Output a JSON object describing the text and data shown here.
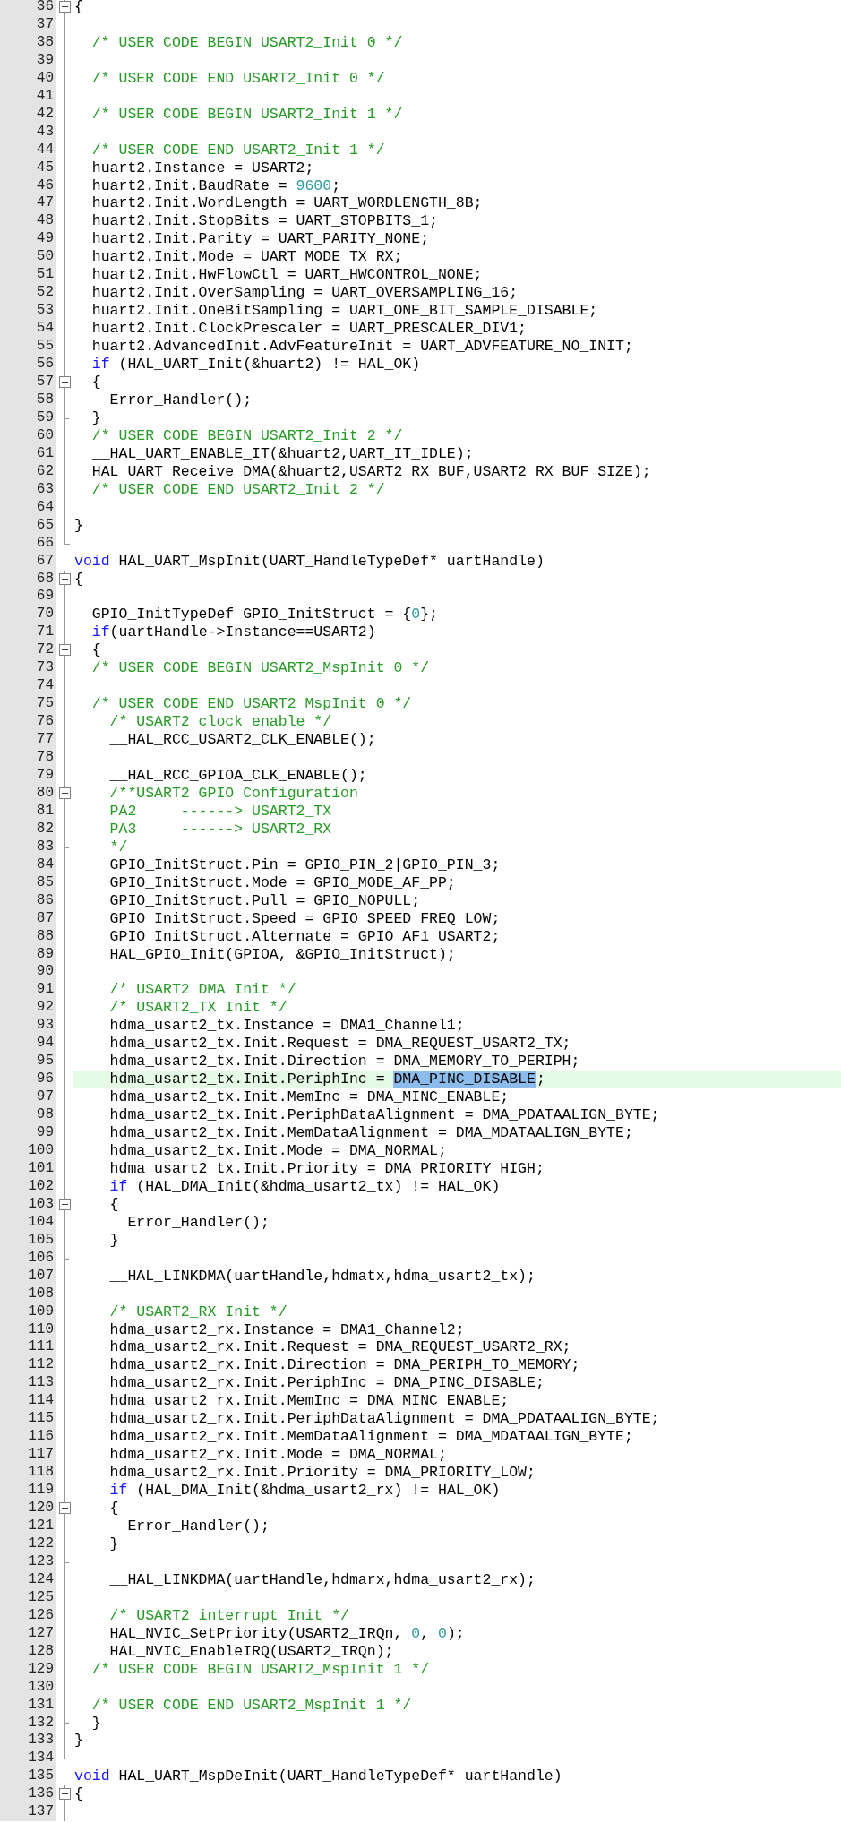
{
  "editor": {
    "lines": [
      {
        "number": "36",
        "kind": "fold-start",
        "current": false,
        "code": [
          {
            "kind": "plain",
            "text": "{"
          }
        ]
      },
      {
        "number": "37",
        "kind": "fold-body",
        "current": false
      },
      {
        "number": "38",
        "kind": "fold-body",
        "current": false,
        "code": [
          {
            "kind": "comment",
            "text": "  /* USER CODE BEGIN USART2_Init 0 */"
          }
        ]
      },
      {
        "number": "39",
        "kind": "fold-body",
        "current": false
      },
      {
        "number": "40",
        "kind": "fold-body",
        "current": false,
        "code": [
          {
            "kind": "comment",
            "text": "  /* USER CODE END USART2_Init 0 */"
          }
        ]
      },
      {
        "number": "41",
        "kind": "fold-body",
        "current": false
      },
      {
        "number": "42",
        "kind": "fold-body",
        "current": false,
        "code": [
          {
            "kind": "comment",
            "text": "  /* USER CODE BEGIN USART2_Init 1 */"
          }
        ]
      },
      {
        "number": "43",
        "kind": "fold-body",
        "current": false
      },
      {
        "number": "44",
        "kind": "fold-body",
        "current": false,
        "code": [
          {
            "kind": "comment",
            "text": "  /* USER CODE END USART2_Init 1 */"
          }
        ]
      },
      {
        "number": "45",
        "kind": "fold-body",
        "current": false,
        "code": [
          {
            "kind": "plain",
            "text": "  huart2.Instance = USART2;"
          }
        ]
      },
      {
        "number": "46",
        "kind": "fold-body",
        "current": false,
        "code": [
          {
            "kind": "plain",
            "text": "  huart2.Init.BaudRate = "
          },
          {
            "kind": "number",
            "text": "9600"
          },
          {
            "kind": "plain",
            "text": ";"
          }
        ]
      },
      {
        "number": "47",
        "kind": "fold-body",
        "current": false,
        "code": [
          {
            "kind": "plain",
            "text": "  huart2.Init.WordLength = UART_WORDLENGTH_8B;"
          }
        ]
      },
      {
        "number": "48",
        "kind": "fold-body",
        "current": false,
        "code": [
          {
            "kind": "plain",
            "text": "  huart2.Init.StopBits = UART_STOPBITS_1;"
          }
        ]
      },
      {
        "number": "49",
        "kind": "fold-body",
        "current": false,
        "code": [
          {
            "kind": "plain",
            "text": "  huart2.Init.Parity = UART_PARITY_NONE;"
          }
        ]
      },
      {
        "number": "50",
        "kind": "fold-body",
        "current": false,
        "code": [
          {
            "kind": "plain",
            "text": "  huart2.Init.Mode = UART_MODE_TX_RX;"
          }
        ]
      },
      {
        "number": "51",
        "kind": "fold-body",
        "current": false,
        "code": [
          {
            "kind": "plain",
            "text": "  huart2.Init.HwFlowCtl = UART_HWCONTROL_NONE;"
          }
        ]
      },
      {
        "number": "52",
        "kind": "fold-body",
        "current": false,
        "code": [
          {
            "kind": "plain",
            "text": "  huart2.Init.OverSampling = UART_OVERSAMPLING_16;"
          }
        ]
      },
      {
        "number": "53",
        "kind": "fold-body",
        "current": false,
        "code": [
          {
            "kind": "plain",
            "text": "  huart2.Init.OneBitSampling = UART_ONE_BIT_SAMPLE_DISABLE;"
          }
        ]
      },
      {
        "number": "54",
        "kind": "fold-body",
        "current": false,
        "code": [
          {
            "kind": "plain",
            "text": "  huart2.Init.ClockPrescaler = UART_PRESCALER_DIV1;"
          }
        ]
      },
      {
        "number": "55",
        "kind": "fold-body",
        "current": false,
        "code": [
          {
            "kind": "plain",
            "text": "  huart2.AdvancedInit.AdvFeatureInit = UART_ADVFEATURE_NO_INIT;"
          }
        ]
      },
      {
        "number": "56",
        "kind": "fold-body",
        "current": false,
        "code": [
          {
            "kind": "keyword",
            "text": "  if"
          },
          {
            "kind": "plain",
            "text": " (HAL_UART_Init(&huart2) != HAL_OK)"
          }
        ]
      },
      {
        "number": "57",
        "kind": "fold-start",
        "current": false,
        "code": [
          {
            "kind": "plain",
            "text": "  {"
          }
        ]
      },
      {
        "number": "58",
        "kind": "fold-body",
        "current": false,
        "code": [
          {
            "kind": "plain",
            "text": "    Error_Handler();"
          }
        ]
      },
      {
        "number": "59",
        "kind": "fold-tail",
        "current": false,
        "code": [
          {
            "kind": "plain",
            "text": "  }"
          }
        ]
      },
      {
        "number": "60",
        "kind": "fold-body",
        "current": false,
        "code": [
          {
            "kind": "comment",
            "text": "  /* USER CODE BEGIN USART2_Init 2 */"
          }
        ]
      },
      {
        "number": "61",
        "kind": "fold-body",
        "current": false,
        "code": [
          {
            "kind": "plain",
            "text": "  __HAL_UART_ENABLE_IT(&huart2,UART_IT_IDLE);"
          }
        ]
      },
      {
        "number": "62",
        "kind": "fold-body",
        "current": false,
        "code": [
          {
            "kind": "plain",
            "text": "  HAL_UART_Receive_DMA(&huart2,USART2_RX_BUF,USART2_RX_BUF_SIZE);"
          }
        ]
      },
      {
        "number": "63",
        "kind": "fold-body",
        "current": false,
        "code": [
          {
            "kind": "comment",
            "text": "  /* USER CODE END USART2_Init 2 */"
          }
        ]
      },
      {
        "number": "64",
        "kind": "fold-body",
        "current": false
      },
      {
        "number": "65",
        "kind": "fold-body",
        "current": false,
        "code": [
          {
            "kind": "plain",
            "text": "}"
          }
        ]
      },
      {
        "number": "66",
        "kind": "fold-end",
        "current": false
      },
      {
        "number": "67",
        "kind": "plain",
        "current": false,
        "code": [
          {
            "kind": "keyword",
            "text": "void"
          },
          {
            "kind": "plain",
            "text": " HAL_UART_MspInit(UART_HandleTypeDef* uartHandle)"
          }
        ]
      },
      {
        "number": "68",
        "kind": "fold-start",
        "current": false,
        "code": [
          {
            "kind": "plain",
            "text": "{"
          }
        ]
      },
      {
        "number": "69",
        "kind": "fold-body",
        "current": false
      },
      {
        "number": "70",
        "kind": "fold-body",
        "current": false,
        "code": [
          {
            "kind": "plain",
            "text": "  GPIO_InitTypeDef GPIO_InitStruct = {"
          },
          {
            "kind": "number",
            "text": "0"
          },
          {
            "kind": "plain",
            "text": "};"
          }
        ]
      },
      {
        "number": "71",
        "kind": "fold-body",
        "current": false,
        "code": [
          {
            "kind": "keyword",
            "text": "  if"
          },
          {
            "kind": "plain",
            "text": "(uartHandle->Instance==USART2)"
          }
        ]
      },
      {
        "number": "72",
        "kind": "fold-start",
        "current": false,
        "code": [
          {
            "kind": "plain",
            "text": "  {"
          }
        ]
      },
      {
        "number": "73",
        "kind": "fold-body",
        "current": false,
        "code": [
          {
            "kind": "comment",
            "text": "  /* USER CODE BEGIN USART2_MspInit 0 */"
          }
        ]
      },
      {
        "number": "74",
        "kind": "fold-body",
        "current": false
      },
      {
        "number": "75",
        "kind": "fold-body",
        "current": false,
        "code": [
          {
            "kind": "comment",
            "text": "  /* USER CODE END USART2_MspInit 0 */"
          }
        ]
      },
      {
        "number": "76",
        "kind": "fold-body",
        "current": false,
        "code": [
          {
            "kind": "comment",
            "text": "    /* USART2 clock enable */"
          }
        ]
      },
      {
        "number": "77",
        "kind": "fold-body",
        "current": false,
        "code": [
          {
            "kind": "plain",
            "text": "    __HAL_RCC_USART2_CLK_ENABLE();"
          }
        ]
      },
      {
        "number": "78",
        "kind": "fold-body",
        "current": false
      },
      {
        "number": "79",
        "kind": "fold-body",
        "current": false,
        "code": [
          {
            "kind": "plain",
            "text": "    __HAL_RCC_GPIOA_CLK_ENABLE();"
          }
        ]
      },
      {
        "number": "80",
        "kind": "fold-start",
        "current": false,
        "code": [
          {
            "kind": "comment",
            "text": "    /**USART2 GPIO Configuration"
          }
        ]
      },
      {
        "number": "81",
        "kind": "fold-body",
        "current": false,
        "code": [
          {
            "kind": "comment",
            "text": "    PA2     ------> USART2_TX"
          }
        ]
      },
      {
        "number": "82",
        "kind": "fold-body",
        "current": false,
        "code": [
          {
            "kind": "comment",
            "text": "    PA3     ------> USART2_RX"
          }
        ]
      },
      {
        "number": "83",
        "kind": "fold-tail",
        "current": false,
        "code": [
          {
            "kind": "comment",
            "text": "    */"
          }
        ]
      },
      {
        "number": "84",
        "kind": "fold-body",
        "current": false,
        "code": [
          {
            "kind": "plain",
            "text": "    GPIO_InitStruct.Pin = GPIO_PIN_2|GPIO_PIN_3;"
          }
        ]
      },
      {
        "number": "85",
        "kind": "fold-body",
        "current": false,
        "code": [
          {
            "kind": "plain",
            "text": "    GPIO_InitStruct.Mode = GPIO_MODE_AF_PP;"
          }
        ]
      },
      {
        "number": "86",
        "kind": "fold-body",
        "current": false,
        "code": [
          {
            "kind": "plain",
            "text": "    GPIO_InitStruct.Pull = GPIO_NOPULL;"
          }
        ]
      },
      {
        "number": "87",
        "kind": "fold-body",
        "current": false,
        "code": [
          {
            "kind": "plain",
            "text": "    GPIO_InitStruct.Speed = GPIO_SPEED_FREQ_LOW;"
          }
        ]
      },
      {
        "number": "88",
        "kind": "fold-body",
        "current": false,
        "code": [
          {
            "kind": "plain",
            "text": "    GPIO_InitStruct.Alternate = GPIO_AF1_USART2;"
          }
        ]
      },
      {
        "number": "89",
        "kind": "fold-body",
        "current": false,
        "code": [
          {
            "kind": "plain",
            "text": "    HAL_GPIO_Init(GPIOA, &GPIO_InitStruct);"
          }
        ]
      },
      {
        "number": "90",
        "kind": "fold-body",
        "current": false
      },
      {
        "number": "91",
        "kind": "fold-body",
        "current": false,
        "code": [
          {
            "kind": "comment",
            "text": "    /* USART2 DMA Init */"
          }
        ]
      },
      {
        "number": "92",
        "kind": "fold-body",
        "current": false,
        "code": [
          {
            "kind": "comment",
            "text": "    /* USART2_TX Init */"
          }
        ]
      },
      {
        "number": "93",
        "kind": "fold-body",
        "current": false,
        "code": [
          {
            "kind": "plain",
            "text": "    hdma_usart2_tx.Instance = DMA1_Channel1;"
          }
        ]
      },
      {
        "number": "94",
        "kind": "fold-body",
        "current": false,
        "code": [
          {
            "kind": "plain",
            "text": "    hdma_usart2_tx.Init.Request = DMA_REQUEST_USART2_TX;"
          }
        ]
      },
      {
        "number": "95",
        "kind": "fold-body",
        "current": false,
        "code": [
          {
            "kind": "plain",
            "text": "    hdma_usart2_tx.Init.Direction = DMA_MEMORY_TO_PERIPH;"
          }
        ]
      },
      {
        "number": "96",
        "kind": "fold-body",
        "current": true,
        "code": [
          {
            "kind": "plain",
            "text": "    hdma_usart2_tx.Init.PeriphInc = "
          },
          {
            "kind": "selection",
            "text": "DMA_PINC_DISABLE"
          },
          {
            "kind": "plain",
            "text": ";"
          }
        ]
      },
      {
        "number": "97",
        "kind": "fold-body",
        "current": false,
        "code": [
          {
            "kind": "plain",
            "text": "    hdma_usart2_tx.Init.MemInc = DMA_MINC_ENABLE;"
          }
        ]
      },
      {
        "number": "98",
        "kind": "fold-body",
        "current": false,
        "code": [
          {
            "kind": "plain",
            "text": "    hdma_usart2_tx.Init.PeriphDataAlignment = DMA_PDATAALIGN_BYTE;"
          }
        ]
      },
      {
        "number": "99",
        "kind": "fold-body",
        "current": false,
        "code": [
          {
            "kind": "plain",
            "text": "    hdma_usart2_tx.Init.MemDataAlignment = DMA_MDATAALIGN_BYTE;"
          }
        ]
      },
      {
        "number": "100",
        "kind": "fold-body",
        "current": false,
        "code": [
          {
            "kind": "plain",
            "text": "    hdma_usart2_tx.Init.Mode = DMA_NORMAL;"
          }
        ]
      },
      {
        "number": "101",
        "kind": "fold-body",
        "current": false,
        "code": [
          {
            "kind": "plain",
            "text": "    hdma_usart2_tx.Init.Priority = DMA_PRIORITY_HIGH;"
          }
        ]
      },
      {
        "number": "102",
        "kind": "fold-body",
        "current": false,
        "code": [
          {
            "kind": "keyword",
            "text": "    if"
          },
          {
            "kind": "plain",
            "text": " (HAL_DMA_Init(&hdma_usart2_tx) != HAL_OK)"
          }
        ]
      },
      {
        "number": "103",
        "kind": "fold-start",
        "current": false,
        "code": [
          {
            "kind": "plain",
            "text": "    {"
          }
        ]
      },
      {
        "number": "104",
        "kind": "fold-body",
        "current": false,
        "code": [
          {
            "kind": "plain",
            "text": "      Error_Handler();"
          }
        ]
      },
      {
        "number": "105",
        "kind": "fold-body",
        "current": false,
        "code": [
          {
            "kind": "plain",
            "text": "    }"
          }
        ]
      },
      {
        "number": "106",
        "kind": "fold-tail",
        "current": false
      },
      {
        "number": "107",
        "kind": "fold-body",
        "current": false,
        "code": [
          {
            "kind": "plain",
            "text": "    __HAL_LINKDMA(uartHandle,hdmatx,hdma_usart2_tx);"
          }
        ]
      },
      {
        "number": "108",
        "kind": "fold-body",
        "current": false
      },
      {
        "number": "109",
        "kind": "fold-body",
        "current": false,
        "code": [
          {
            "kind": "comment",
            "text": "    /* USART2_RX Init */"
          }
        ]
      },
      {
        "number": "110",
        "kind": "fold-body",
        "current": false,
        "code": [
          {
            "kind": "plain",
            "text": "    hdma_usart2_rx.Instance = DMA1_Channel2;"
          }
        ]
      },
      {
        "number": "111",
        "kind": "fold-body",
        "current": false,
        "code": [
          {
            "kind": "plain",
            "text": "    hdma_usart2_rx.Init.Request = DMA_REQUEST_USART2_RX;"
          }
        ]
      },
      {
        "number": "112",
        "kind": "fold-body",
        "current": false,
        "code": [
          {
            "kind": "plain",
            "text": "    hdma_usart2_rx.Init.Direction = DMA_PERIPH_TO_MEMORY;"
          }
        ]
      },
      {
        "number": "113",
        "kind": "fold-body",
        "current": false,
        "code": [
          {
            "kind": "plain",
            "text": "    hdma_usart2_rx.Init.PeriphInc = DMA_PINC_DISABLE;"
          }
        ]
      },
      {
        "number": "114",
        "kind": "fold-body",
        "current": false,
        "code": [
          {
            "kind": "plain",
            "text": "    hdma_usart2_rx.Init.MemInc = DMA_MINC_ENABLE;"
          }
        ]
      },
      {
        "number": "115",
        "kind": "fold-body",
        "current": false,
        "code": [
          {
            "kind": "plain",
            "text": "    hdma_usart2_rx.Init.PeriphDataAlignment = DMA_PDATAALIGN_BYTE;"
          }
        ]
      },
      {
        "number": "116",
        "kind": "fold-body",
        "current": false,
        "code": [
          {
            "kind": "plain",
            "text": "    hdma_usart2_rx.Init.MemDataAlignment = DMA_MDATAALIGN_BYTE;"
          }
        ]
      },
      {
        "number": "117",
        "kind": "fold-body",
        "current": false,
        "code": [
          {
            "kind": "plain",
            "text": "    hdma_usart2_rx.Init.Mode = DMA_NORMAL;"
          }
        ]
      },
      {
        "number": "118",
        "kind": "fold-body",
        "current": false,
        "code": [
          {
            "kind": "plain",
            "text": "    hdma_usart2_rx.Init.Priority = DMA_PRIORITY_LOW;"
          }
        ]
      },
      {
        "number": "119",
        "kind": "fold-body",
        "current": false,
        "code": [
          {
            "kind": "keyword",
            "text": "    if"
          },
          {
            "kind": "plain",
            "text": " (HAL_DMA_Init(&hdma_usart2_rx) != HAL_OK)"
          }
        ]
      },
      {
        "number": "120",
        "kind": "fold-start",
        "current": false,
        "code": [
          {
            "kind": "plain",
            "text": "    {"
          }
        ]
      },
      {
        "number": "121",
        "kind": "fold-body",
        "current": false,
        "code": [
          {
            "kind": "plain",
            "text": "      Error_Handler();"
          }
        ]
      },
      {
        "number": "122",
        "kind": "fold-body",
        "current": false,
        "code": [
          {
            "kind": "plain",
            "text": "    }"
          }
        ]
      },
      {
        "number": "123",
        "kind": "fold-tail",
        "current": false
      },
      {
        "number": "124",
        "kind": "fold-body",
        "current": false,
        "code": [
          {
            "kind": "plain",
            "text": "    __HAL_LINKDMA(uartHandle,hdmarx,hdma_usart2_rx);"
          }
        ]
      },
      {
        "number": "125",
        "kind": "fold-body",
        "current": false
      },
      {
        "number": "126",
        "kind": "fold-body",
        "current": false,
        "code": [
          {
            "kind": "comment",
            "text": "    /* USART2 interrupt Init */"
          }
        ]
      },
      {
        "number": "127",
        "kind": "fold-body",
        "current": false,
        "code": [
          {
            "kind": "plain",
            "text": "    HAL_NVIC_SetPriority(USART2_IRQn, "
          },
          {
            "kind": "number",
            "text": "0"
          },
          {
            "kind": "plain",
            "text": ", "
          },
          {
            "kind": "number",
            "text": "0"
          },
          {
            "kind": "plain",
            "text": ");"
          }
        ]
      },
      {
        "number": "128",
        "kind": "fold-body",
        "current": false,
        "code": [
          {
            "kind": "plain",
            "text": "    HAL_NVIC_EnableIRQ(USART2_IRQn);"
          }
        ]
      },
      {
        "number": "129",
        "kind": "fold-body",
        "current": false,
        "code": [
          {
            "kind": "comment",
            "text": "  /* USER CODE BEGIN USART2_MspInit 1 */"
          }
        ]
      },
      {
        "number": "130",
        "kind": "fold-body",
        "current": false
      },
      {
        "number": "131",
        "kind": "fold-body",
        "current": false,
        "code": [
          {
            "kind": "comment",
            "text": "  /* USER CODE END USART2_MspInit 1 */"
          }
        ]
      },
      {
        "number": "132",
        "kind": "fold-tail",
        "current": false,
        "code": [
          {
            "kind": "plain",
            "text": "  }"
          }
        ]
      },
      {
        "number": "133",
        "kind": "fold-body",
        "current": false,
        "code": [
          {
            "kind": "plain",
            "text": "}"
          }
        ]
      },
      {
        "number": "134",
        "kind": "fold-end",
        "current": false
      },
      {
        "number": "135",
        "kind": "plain",
        "current": false,
        "code": [
          {
            "kind": "keyword",
            "text": "void"
          },
          {
            "kind": "plain",
            "text": " HAL_UART_MspDeInit(UART_HandleTypeDef* uartHandle)"
          }
        ]
      },
      {
        "number": "136",
        "kind": "fold-start",
        "current": false,
        "code": [
          {
            "kind": "plain",
            "text": "{"
          }
        ]
      },
      {
        "number": "137",
        "kind": "fold-body",
        "current": false
      }
    ]
  }
}
